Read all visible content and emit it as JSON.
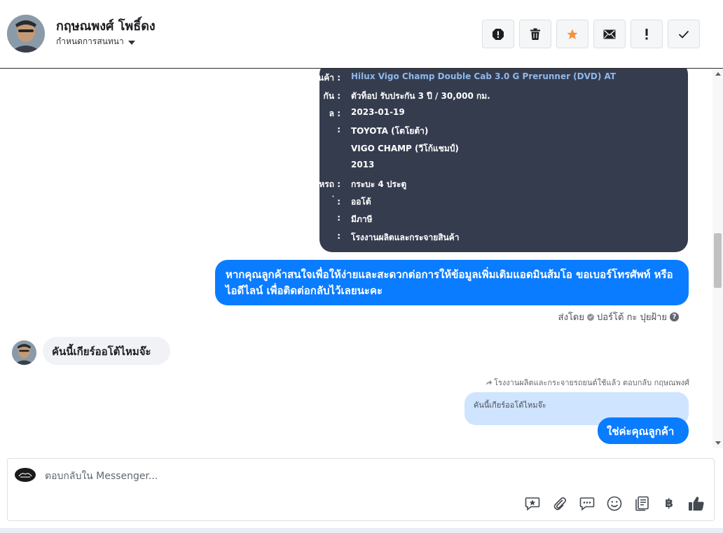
{
  "header": {
    "contact_name": "กฤษณพงศ์ โพธิ์ดง",
    "assign_label": "กำหนดการสนทนา",
    "actions": [
      {
        "icon": "report-spam-icon"
      },
      {
        "icon": "trash-icon"
      },
      {
        "icon": "star-icon",
        "color": "#f7923b"
      },
      {
        "icon": "envelope-icon"
      },
      {
        "icon": "exclamation-icon"
      },
      {
        "icon": "checkmark-icon"
      }
    ]
  },
  "product_card": {
    "rows": [
      {
        "label": "นค้า :",
        "value": "Hilux Vigo Champ Double Cab 3.0 G Prerunner (DVD) AT",
        "link": true
      },
      {
        "label": "กัน :",
        "value": "ตัวท็อป รับประกัน 3 ปี / 30,000 กม."
      },
      {
        "label": "ล :",
        "value": "2023-01-19"
      },
      {
        "label": ":",
        "value": "TOYOTA (โตโยต้า)"
      },
      {
        "label": "",
        "value": "VIGO CHAMP (วีโก้แชมป์)"
      },
      {
        "label": "",
        "value": "2013"
      },
      {
        "label": "กหรถ :",
        "value": "กระบะ 4 ประตู"
      },
      {
        "label": "่ :",
        "value": "ออโต้"
      },
      {
        "label": ":",
        "value": "มีภาษี"
      },
      {
        "label": ":",
        "value": "โรงงานผลิตและกระจายสินค้า"
      }
    ]
  },
  "messages": {
    "outgoing_main": "หากคุณลูกค้าสนใจเพื่อให้ง่ายและสะดวกต่อการให้ข้อมูลเพิ่มเติมแอดมินส้มโอ ขอเบอร์โทรศัพท์ หรือ ไอดีไลน์ เพื่อติดต่อกลับไว้เลยนะคะ",
    "sent_by_prefix": "ส่งโดย",
    "sent_by_name": "ปอร์โต้ กะ ปุยฝ้าย",
    "incoming": "คันนี้เกียร์ออโต้ไหมจ๊ะ",
    "reply_note": "โรงงานผลิตและกระจายรถยนต์ใช้แล้ว ตอบกลับ กฤษณพงศ์",
    "quoted": "คันนี้เกียร์ออโต้ไหมจ๊ะ",
    "outgoing_reply": "ใช่ค่ะคุณลูกค้า"
  },
  "composer": {
    "placeholder": "ตอบกลับใน Messenger...",
    "tools": [
      {
        "icon": "saved-reply-icon"
      },
      {
        "icon": "attachment-icon"
      },
      {
        "icon": "chat-bubbles-icon"
      },
      {
        "icon": "emoji-icon"
      },
      {
        "icon": "catalog-icon"
      },
      {
        "icon": "baht-payment-icon",
        "glyph": "฿"
      },
      {
        "icon": "thumbs-up-icon"
      }
    ]
  },
  "colors": {
    "accent_blue": "#0a7cff",
    "card_bg": "#353c4e",
    "card_link": "#8fb8e8",
    "star": "#f7923b"
  }
}
